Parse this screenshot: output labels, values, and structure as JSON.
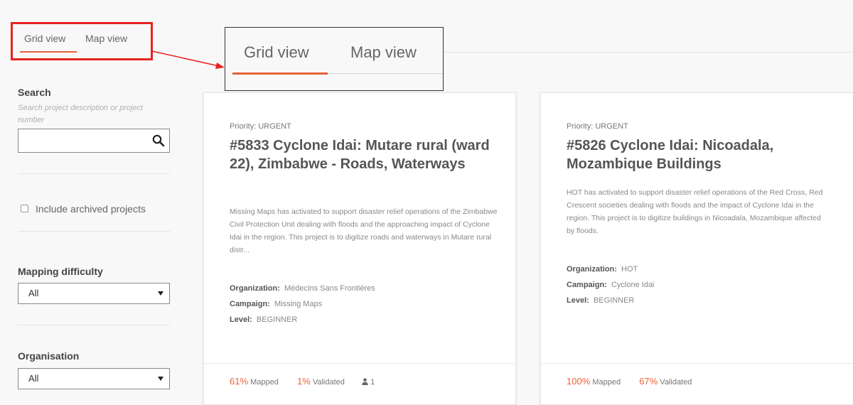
{
  "view_tabs": {
    "grid": "Grid view",
    "map": "Map view",
    "active": "Grid view"
  },
  "sidebar": {
    "search_title": "Search",
    "search_hint": "Search project description or project number",
    "search_value": "",
    "archived_label": "Include archived projects",
    "archived_checked": false,
    "difficulty_title": "Mapping difficulty",
    "difficulty_value": "All",
    "organisation_title": "Organisation",
    "organisation_value": "All"
  },
  "projects": [
    {
      "priority": "Priority: URGENT",
      "title": "#5833 Cyclone Idai: Mutare rural (ward 22), Zimbabwe - Roads, Waterways",
      "description": "Missing Maps has activated to support disaster relief operations of the Zimbabwe Civil Protection Unit dealing with floods and the approaching impact of Cyclone Idai in the region. This project is to digitize roads and waterways in Mutare rural distr...",
      "organization_label": "Organization:",
      "organization": "Médecins Sans Frontières",
      "campaign_label": "Campaign:",
      "campaign": "Missing Maps",
      "level_label": "Level:",
      "level": "BEGINNER",
      "mapped_pct": "61%",
      "mapped_label": "Mapped",
      "validated_pct": "1%",
      "validated_label": "Validated",
      "contributors": "1"
    },
    {
      "priority": "Priority: URGENT",
      "title": "#5826 Cyclone Idai: Nicoadala, Mozambique Buildings",
      "description": "HOT has activated to support disaster relief operations of the Red Cross, Red Crescent societies dealing with floods and the impact of Cyclone Idai in the region. This project is to digitize buildings in Nicoadala, Mozambique affected by floods.",
      "organization_label": "Organization:",
      "organization": "HOT",
      "campaign_label": "Campaign:",
      "campaign": "Cyclone Idai",
      "level_label": "Level:",
      "level": "BEGINNER",
      "mapped_pct": "100%",
      "mapped_label": "Mapped",
      "validated_pct": "67%",
      "validated_label": "Validated"
    }
  ],
  "colors": {
    "accent": "#e8623a",
    "highlight": "#e8231f"
  },
  "icons": {
    "search": "search-icon",
    "users": "user-icon",
    "caret": "chevron-down-icon"
  }
}
